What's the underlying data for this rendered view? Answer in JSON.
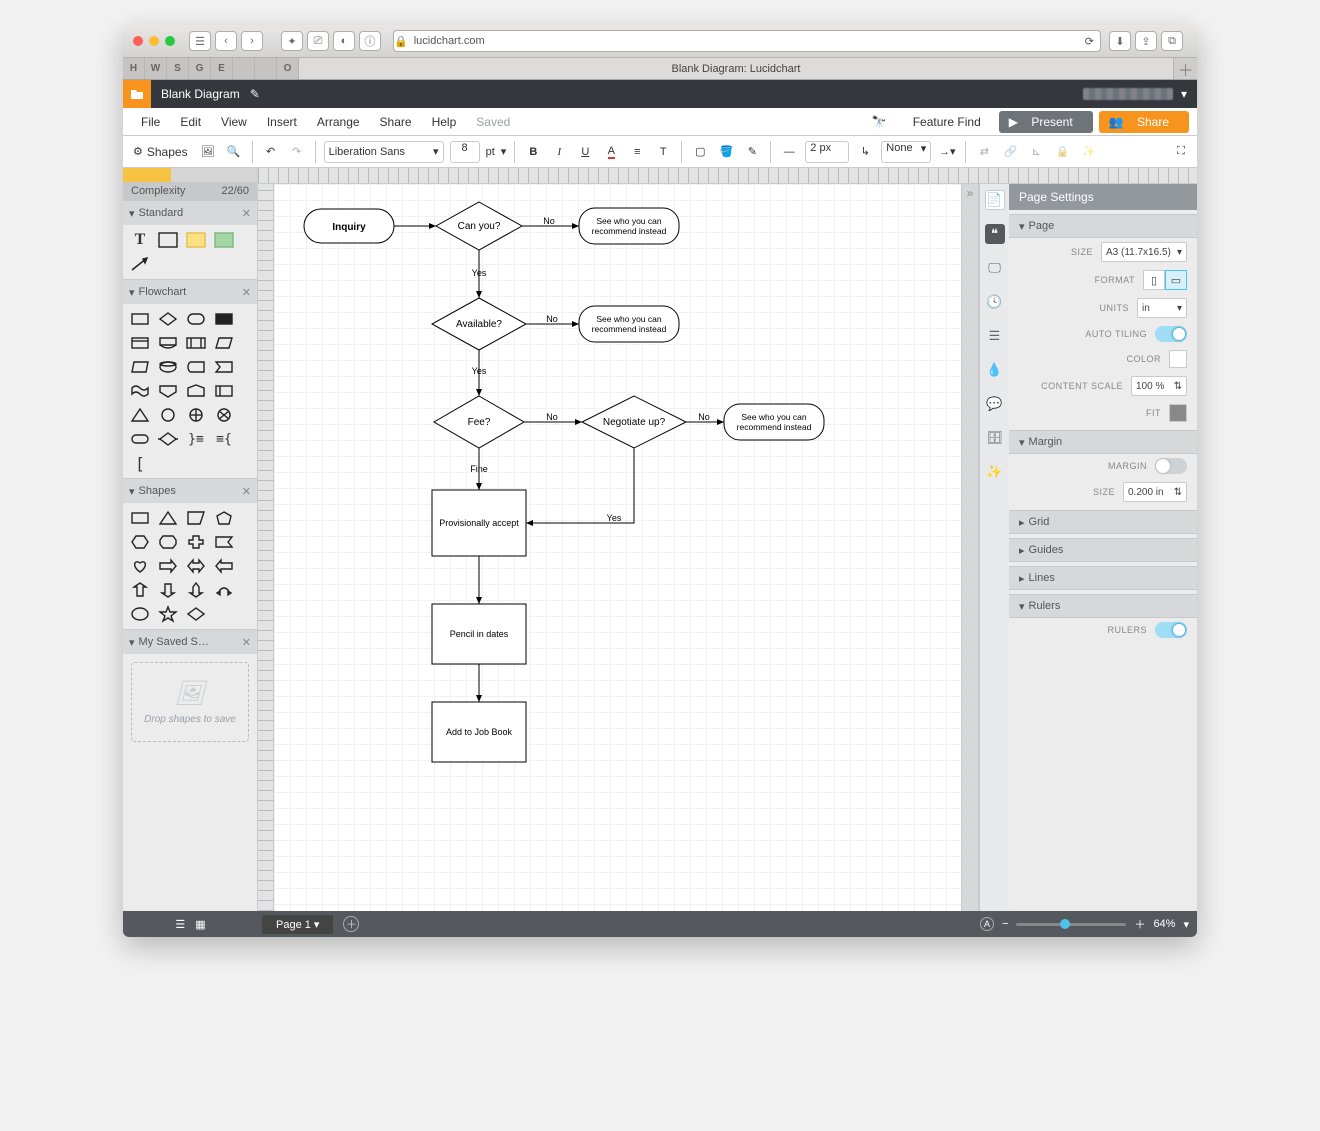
{
  "browser": {
    "url_host": "lucidchart.com",
    "tab_title": "Blank Diagram: Lucidchart",
    "fav_tabs": [
      "H",
      "W",
      "S",
      "G",
      "E",
      "",
      "",
      "",
      " O"
    ]
  },
  "app": {
    "doc_title": "Blank Diagram",
    "menus": [
      "File",
      "Edit",
      "View",
      "Insert",
      "Arrange",
      "Share",
      "Help"
    ],
    "saved_label": "Saved",
    "feature_find": "Feature Find",
    "present": "Present",
    "share": "Share"
  },
  "toolbar": {
    "shapes_btn": "Shapes",
    "font": "Liberation Sans",
    "font_size": "8",
    "font_unit": "pt",
    "line_width": "2 px",
    "line_style": "None"
  },
  "left_panel": {
    "complexity_label": "Complexity",
    "complexity_value": "22/60",
    "groups": {
      "standard": "Standard",
      "flowchart": "Flowchart",
      "shapes": "Shapes",
      "mysaved": "My Saved S…"
    },
    "drop_hint": "Drop shapes to save"
  },
  "right_panel": {
    "title": "Page Settings",
    "page": {
      "header": "Page",
      "size_label": "SIZE",
      "size_value": "A3 (11.7x16.5)",
      "format_label": "FORMAT",
      "units_label": "UNITS",
      "units_value": "in",
      "auto_tiling_label": "AUTO TILING",
      "color_label": "COLOR",
      "content_scale_label": "CONTENT SCALE",
      "content_scale_value": "100 %",
      "fit_label": "FIT"
    },
    "margin": {
      "header": "Margin",
      "margin_label": "MARGIN",
      "size_label": "SIZE",
      "size_value": "0.200 in"
    },
    "grid_header": "Grid",
    "guides_header": "Guides",
    "lines_header": "Lines",
    "rulers": {
      "header": "Rulers",
      "label": "RULERS"
    }
  },
  "status": {
    "page_label": "Page 1",
    "zoom_value": "64%"
  },
  "flowchart": {
    "nodes": {
      "inquiry": "Inquiry",
      "can_you": "Can you?",
      "recommend": "See who you can recommend instead",
      "available": "Available?",
      "fee": "Fee?",
      "negotiate": "Negotiate up?",
      "accept": "Provisionally accept",
      "pencil": "Pencil in dates",
      "jobbook": "Add to Job Book"
    },
    "labels": {
      "yes": "Yes",
      "no": "No",
      "fine": "Fine"
    }
  }
}
